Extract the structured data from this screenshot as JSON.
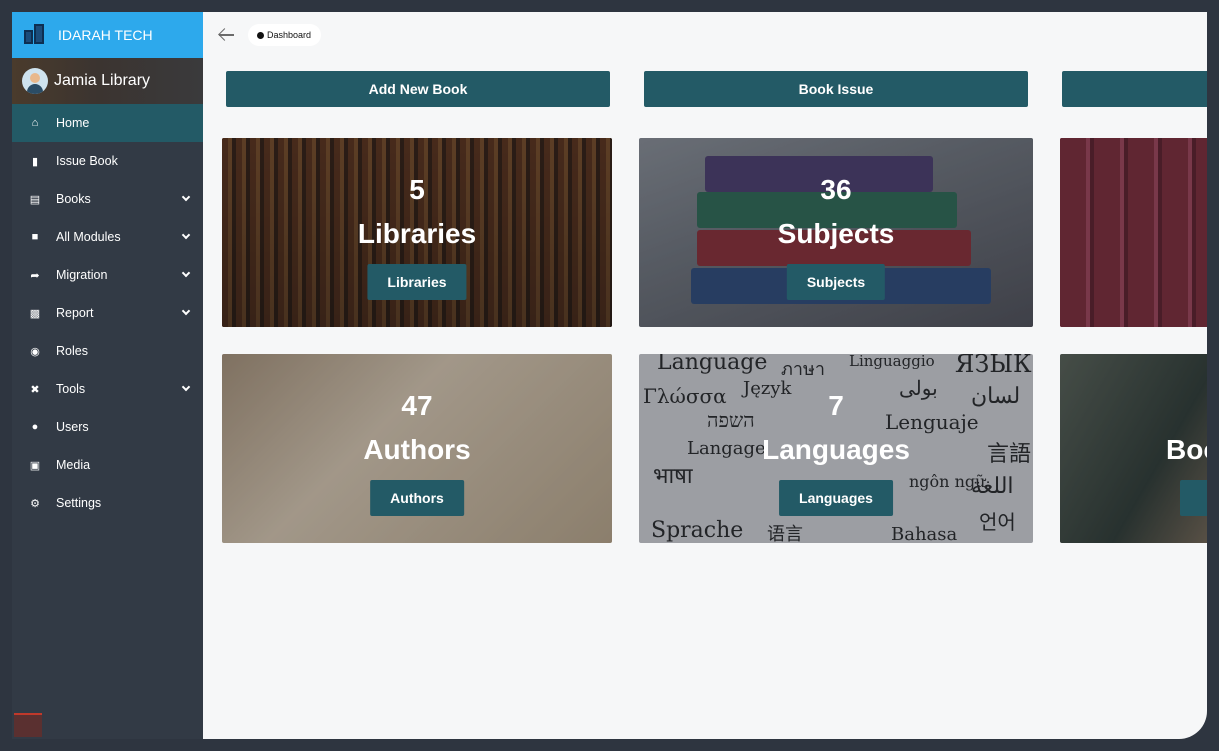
{
  "brand": {
    "name": "IDARAH TECH"
  },
  "user": {
    "name": "Jamia Library"
  },
  "sidebar": {
    "items": [
      {
        "label": "Home",
        "icon": "home-icon",
        "active": true,
        "expandable": false
      },
      {
        "label": "Issue Book",
        "icon": "book-icon",
        "active": false,
        "expandable": false
      },
      {
        "label": "Books",
        "icon": "books-icon",
        "active": false,
        "expandable": true
      },
      {
        "label": "All Modules",
        "icon": "puzzle-icon",
        "active": false,
        "expandable": true
      },
      {
        "label": "Migration",
        "icon": "share-arrow-icon",
        "active": false,
        "expandable": true
      },
      {
        "label": "Report",
        "icon": "chart-icon",
        "active": false,
        "expandable": true
      },
      {
        "label": "Roles",
        "icon": "lock-icon",
        "active": false,
        "expandable": false
      },
      {
        "label": "Tools",
        "icon": "tools-icon",
        "active": false,
        "expandable": true
      },
      {
        "label": "Users",
        "icon": "user-icon",
        "active": false,
        "expandable": false
      },
      {
        "label": "Media",
        "icon": "image-icon",
        "active": false,
        "expandable": false
      },
      {
        "label": "Settings",
        "icon": "gear-icon",
        "active": false,
        "expandable": false
      }
    ]
  },
  "breadcrumb": {
    "label": "Dashboard"
  },
  "actions": {
    "add_book": "Add New Book",
    "book_issue": "Book Issue"
  },
  "cards": {
    "libraries": {
      "count": "5",
      "title": "Libraries",
      "button": "Libraries"
    },
    "subjects": {
      "count": "36",
      "title": "Subjects",
      "button": "Subjects"
    },
    "authors": {
      "count": "47",
      "title": "Authors",
      "button": "Authors"
    },
    "languages": {
      "count": "7",
      "title": "Languages",
      "button": "Languages"
    },
    "partial_title": "Boo"
  },
  "language_words": [
    "Language",
    "ภาษา",
    "Linguaggio",
    "ЯЗЫК",
    "Γλώσσα",
    "Język",
    "بولی",
    "لسان",
    "השפה",
    "Lenguaje",
    "Langage",
    "भाषा",
    "言語",
    "ngôn ngữ",
    "اللغة",
    "Sprache",
    "语言",
    "Bahasa",
    "언어"
  ],
  "colors": {
    "brand_bar": "#2da9ec",
    "sidebar_bg": "#323a45",
    "accent": "#235a66",
    "content_bg": "#f6f7f8"
  }
}
